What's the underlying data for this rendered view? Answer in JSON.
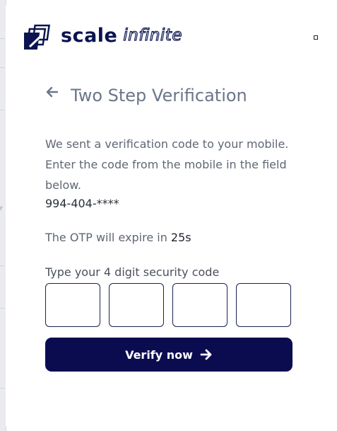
{
  "brand": {
    "name_bold": "scale",
    "name_outline": "infinite",
    "logo_icon": "scale-infinite-logo-icon",
    "primary_color": "#0b0c4f"
  },
  "side_fragment": "r",
  "header": {
    "back_icon": "arrow-left-icon",
    "title": "Two Step Verification"
  },
  "body": {
    "message": "We sent a verification code to your mobile. Enter the code from the mobile in the field below.",
    "phone": "994-404-****",
    "expiry_prefix": "The OTP will expire in ",
    "expiry_seconds": "25s"
  },
  "form": {
    "label": "Type your 4 digit security code",
    "digits": [
      "",
      "",
      "",
      ""
    ]
  },
  "actions": {
    "verify_label": "Verify now",
    "verify_icon": "arrow-right-icon"
  }
}
